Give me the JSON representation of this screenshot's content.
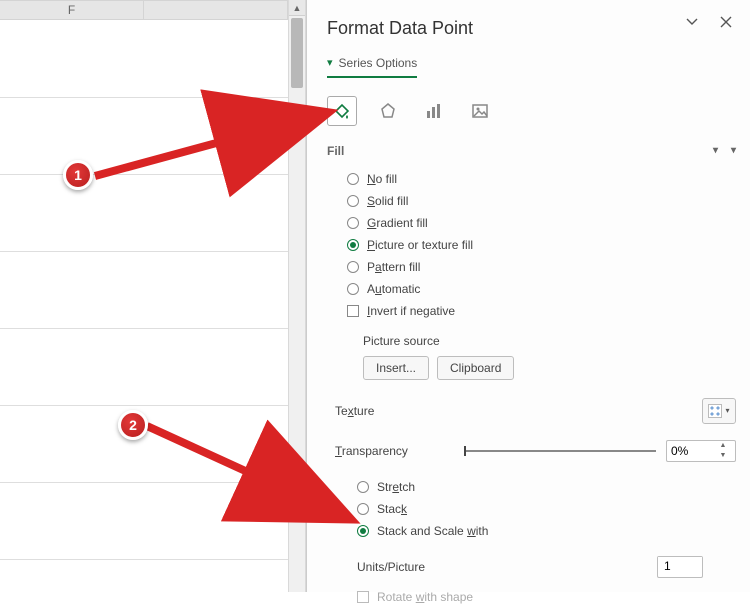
{
  "grid": {
    "column_letter": "F"
  },
  "panel": {
    "title": "Format Data Point",
    "tab_label": "Series Options",
    "categories": {
      "fill": "Fill & Line",
      "effects": "Effects",
      "size": "Size & Properties",
      "picture": "Picture"
    },
    "fill_section": {
      "heading": "Fill",
      "options": {
        "no_fill_html": "<u>N</u>o fill",
        "solid_fill_html": "<u>S</u>olid fill",
        "gradient_fill_html": "<u>G</u>radient fill",
        "picture_fill_html": "<u>P</u>icture or texture fill",
        "pattern_fill_html": "P<u>a</u>ttern fill",
        "automatic_html": "A<u>u</u>tomatic",
        "invert_html": "<u>I</u>nvert if negative",
        "selected": "picture_fill"
      },
      "picture_source": {
        "label": "Picture source",
        "insert_label": "Insert...",
        "clipboard_label": "Clipboard"
      },
      "texture_label_html": "Te<u>x</u>ture",
      "transparency_label_html": "<u>T</u>ransparency",
      "transparency_value": "0%",
      "tile": {
        "stretch_html": "Str<u>e</u>tch",
        "stack_html": "Stac<u>k</u>",
        "stack_scale_html": "Stack and Scale <u>w</u>ith",
        "selected": "stack_scale"
      },
      "units_label": "Units/Picture",
      "units_value": "1",
      "rotate_html": "Rotate <u>w</u>ith shape"
    }
  },
  "annotations": {
    "badge1": "1",
    "badge2": "2"
  }
}
